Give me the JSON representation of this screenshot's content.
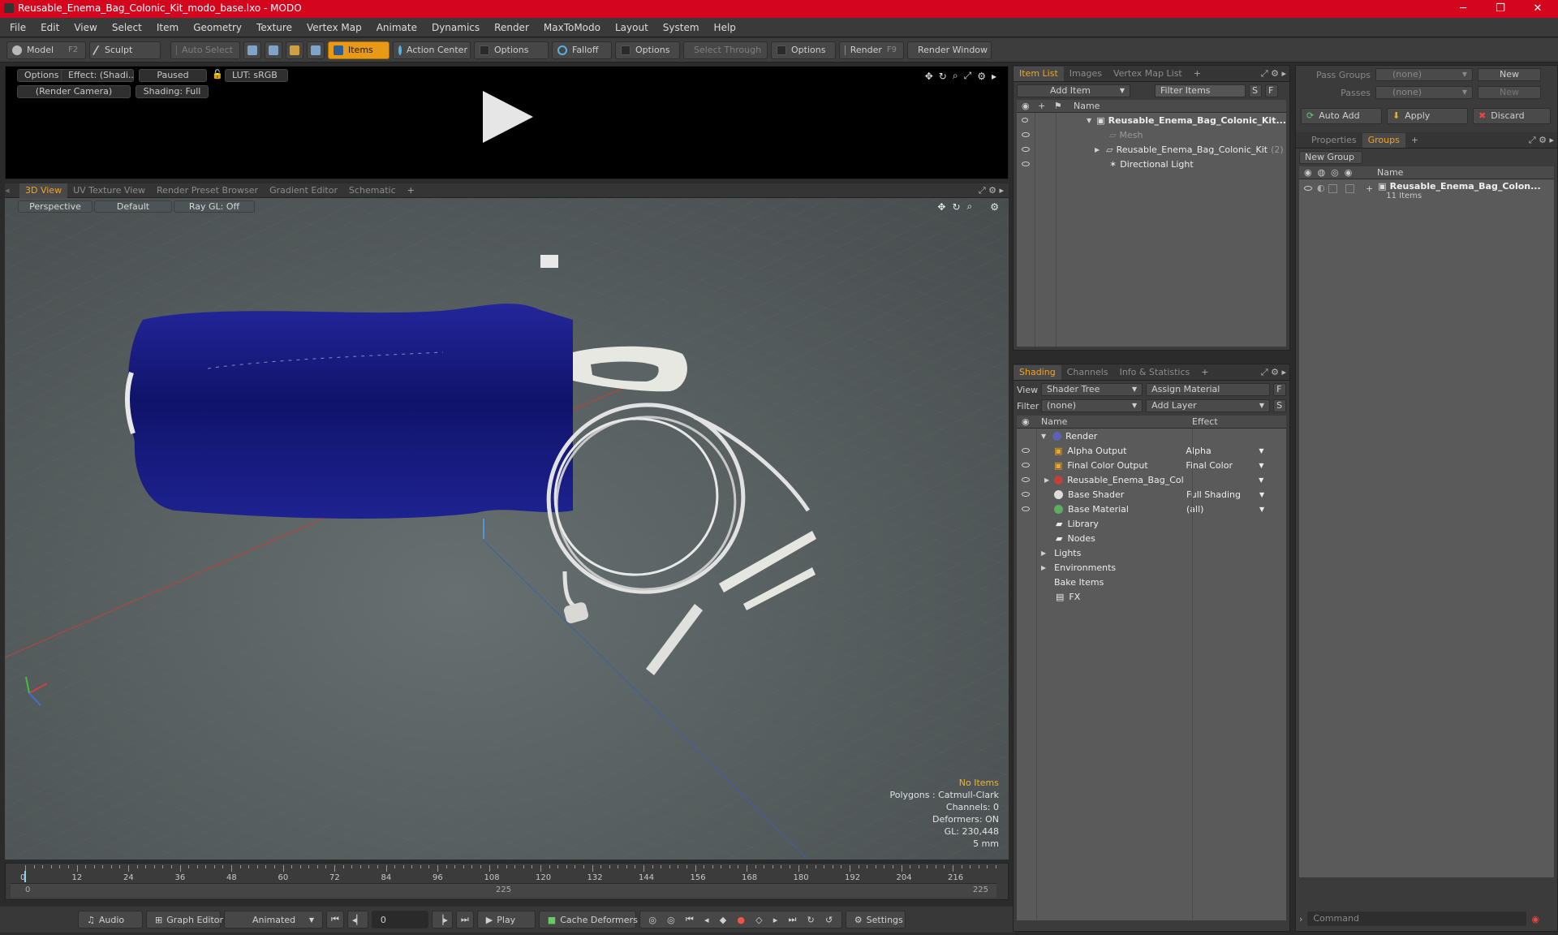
{
  "window": {
    "title": "Reusable_Enema_Bag_Colonic_Kit_modo_base.lxo - MODO"
  },
  "menu": [
    "File",
    "Edit",
    "View",
    "Select",
    "Item",
    "Geometry",
    "Texture",
    "Vertex Map",
    "Animate",
    "Dynamics",
    "Render",
    "MaxToModo",
    "Layout",
    "System",
    "Help"
  ],
  "toolbar": {
    "model": "Model",
    "model_key": "F2",
    "sculpt": "Sculpt",
    "auto_select": "Auto Select",
    "items": "Items",
    "action_center": "Action Center",
    "options1": "Options",
    "falloff": "Falloff",
    "options2": "Options",
    "select_through": "Select Through",
    "options3": "Options",
    "render": "Render",
    "render_key": "F9",
    "render_window": "Render Window"
  },
  "preview": {
    "options": "Options",
    "effect": "Effect: (Shadi...",
    "paused": "Paused",
    "lut": "LUT: sRGB",
    "camera": "(Render Camera)",
    "shading": "Shading: Full"
  },
  "viewport_tabs": [
    "3D View",
    "UV Texture View",
    "Render Preset Browser",
    "Gradient Editor",
    "Schematic"
  ],
  "viewport": {
    "perspective": "Perspective",
    "default": "Default",
    "raygl": "Ray GL: Off",
    "stats": [
      "No Items",
      "Polygons : Catmull-Clark",
      "Channels: 0",
      "Deformers: ON",
      "GL: 230,448",
      "5 mm"
    ]
  },
  "timeline": {
    "ticks": [
      "0",
      "12",
      "24",
      "36",
      "48",
      "60",
      "72",
      "84",
      "96",
      "108",
      "120",
      "132",
      "144",
      "156",
      "168",
      "180",
      "192",
      "204",
      "216"
    ],
    "start": "0",
    "mid": "225",
    "end": "225"
  },
  "transport": {
    "audio": "Audio",
    "graph_editor": "Graph Editor",
    "animated": "Animated",
    "frame": "0",
    "play": "Play",
    "cache": "Cache Deformers",
    "settings": "Settings"
  },
  "item_list": {
    "tabs": [
      "Item List",
      "Images",
      "Vertex Map List"
    ],
    "add_item": "Add Item",
    "filter": "Filter Items",
    "s": "S",
    "f": "F",
    "col_name": "Name",
    "rows": [
      {
        "name": "Reusable_Enema_Bag_Colonic_Kit...",
        "extra": ""
      },
      {
        "name": "Mesh",
        "extra": ""
      },
      {
        "name": "Reusable_Enema_Bag_Colonic_Kit",
        "extra": "(2)"
      },
      {
        "name": "Directional Light",
        "extra": ""
      }
    ]
  },
  "shading": {
    "tabs": [
      "Shading",
      "Channels",
      "Info & Statistics"
    ],
    "view_label": "View",
    "view_value": "Shader Tree",
    "assign": "Assign Material",
    "f": "F",
    "filter_label": "Filter",
    "filter_value": "(none)",
    "add_layer": "Add Layer",
    "s": "S",
    "col_name": "Name",
    "col_effect": "Effect",
    "rows": [
      {
        "name": "Render",
        "effect": ""
      },
      {
        "name": "Alpha Output",
        "effect": "Alpha"
      },
      {
        "name": "Final Color Output",
        "effect": "Final Color"
      },
      {
        "name": "Reusable_Enema_Bag_Col ...",
        "effect": ""
      },
      {
        "name": "Base Shader",
        "effect": "Full Shading"
      },
      {
        "name": "Base Material",
        "effect": "(all)"
      },
      {
        "name": "Library",
        "effect": ""
      },
      {
        "name": "Nodes",
        "effect": ""
      },
      {
        "name": "Lights",
        "effect": ""
      },
      {
        "name": "Environments",
        "effect": ""
      },
      {
        "name": "Bake Items",
        "effect": ""
      },
      {
        "name": "FX",
        "effect": ""
      }
    ]
  },
  "groups_panel": {
    "pass_groups_label": "Pass Groups",
    "pass_groups_value": "(none)",
    "new": "New",
    "passes_label": "Passes",
    "passes_value": "(none)",
    "new2": "New",
    "auto_add": "Auto Add",
    "apply": "Apply",
    "discard": "Discard",
    "tabs": [
      "Properties",
      "Groups"
    ],
    "new_group": "New Group",
    "col_name": "Name",
    "group_name": "Reusable_Enema_Bag_Colon...",
    "group_count": "11 Items",
    "command": "Command"
  }
}
